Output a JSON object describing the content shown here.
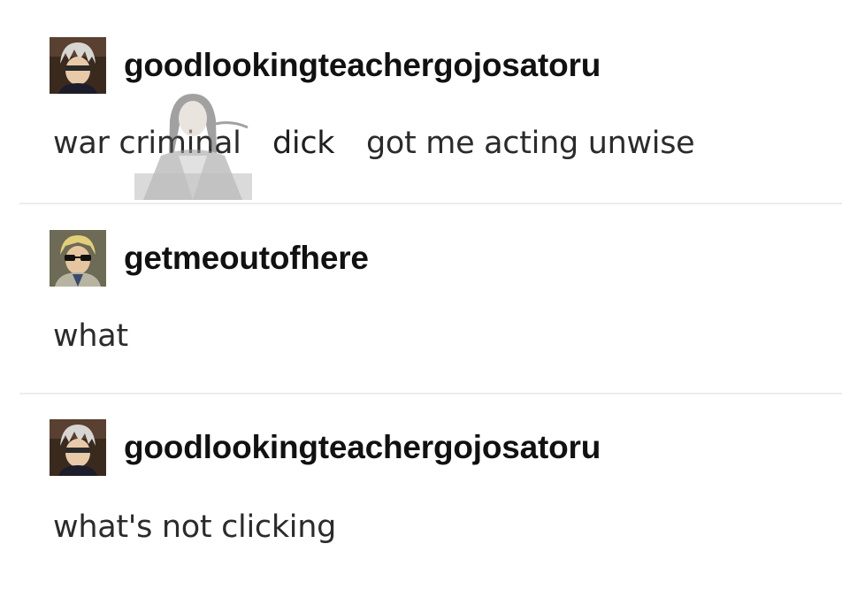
{
  "posts": [
    {
      "username": "goodlookingteachergojosatoru",
      "avatar_icon": "white-haired-character-avatar",
      "text_parts": [
        "war criminal",
        "dick",
        "got me acting unwise"
      ],
      "inline_image_icon": "long-haired-character-sticker"
    },
    {
      "username": "getmeoutofhere",
      "avatar_icon": "blonde-sunglasses-character-avatar",
      "text": "what"
    },
    {
      "username": "goodlookingteachergojosatoru",
      "avatar_icon": "white-haired-character-avatar",
      "text": "what's not clicking"
    }
  ],
  "colors": {
    "text": "#2b2b2b",
    "username": "#111111",
    "divider": "#ececec",
    "background": "#ffffff"
  }
}
